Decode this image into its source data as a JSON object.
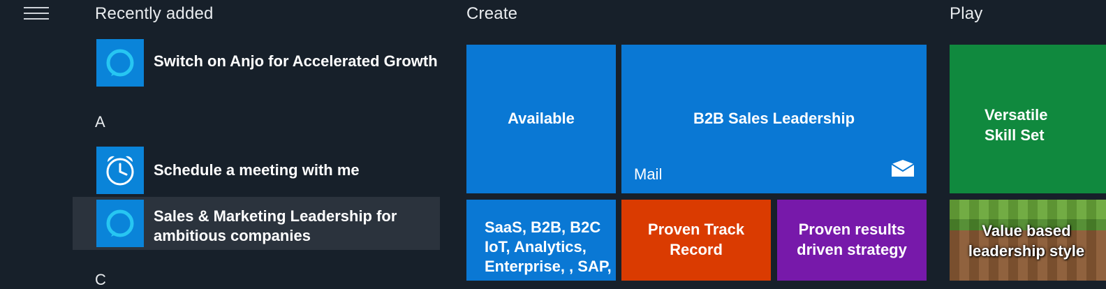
{
  "menu": {
    "icon": "hamburger-menu-icon"
  },
  "sections": {
    "recent": "Recently added",
    "create": "Create",
    "play": "Play"
  },
  "apps": [
    {
      "label": "Switch on Anjo for Accelerated Growth",
      "icon": "alexa-ring-icon"
    },
    {
      "label": "Schedule a meeting with me",
      "icon": "alarm-clock-icon"
    },
    {
      "label_lines": [
        "Sales & Marketing Leadership for",
        "ambitious companies"
      ],
      "icon": "alexa-ring-icon"
    }
  ],
  "letter_header": "A",
  "tiles": {
    "available": "Available",
    "mail": {
      "title": "B2B Sales Leadership",
      "app_name": "Mail",
      "icon": "mail-envelope-icon"
    },
    "versatile": [
      "Versatile",
      "Skill Set"
    ],
    "saas": [
      "SaaS, B2B, B2C",
      "IoT, Analytics,",
      "Enterprise, , SAP,"
    ],
    "proven_track": [
      "Proven Track",
      "Record"
    ],
    "proven_results": [
      "Proven results",
      "driven strategy"
    ],
    "value_based": [
      "Value based",
      "leadership style"
    ]
  },
  "colors": {
    "background": "#17202a",
    "tile_blue": "#0a78d4",
    "tile_orange": "#da3b01",
    "tile_purple": "#7719aa",
    "tile_green": "#10893e",
    "icon_blue": "#0a84d9"
  }
}
